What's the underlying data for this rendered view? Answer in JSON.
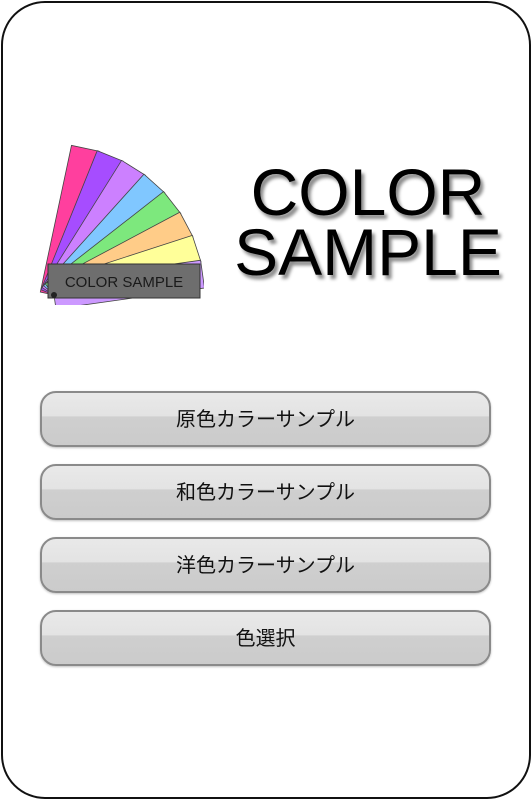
{
  "logo": {
    "badge_text": "COLOR SAMPLE",
    "swatch_colors": [
      "#ff3f9e",
      "#a64dff",
      "#cc80ff",
      "#80c7ff",
      "#7de87d",
      "#ffcc88",
      "#ffff99",
      "#cc99ff"
    ]
  },
  "title": {
    "line1": "COLOR",
    "line2": "SAMPLE"
  },
  "menu": {
    "items": [
      {
        "label": "原色カラーサンプル"
      },
      {
        "label": "和色カラーサンプル"
      },
      {
        "label": "洋色カラーサンプル"
      },
      {
        "label": "色選択"
      }
    ]
  }
}
